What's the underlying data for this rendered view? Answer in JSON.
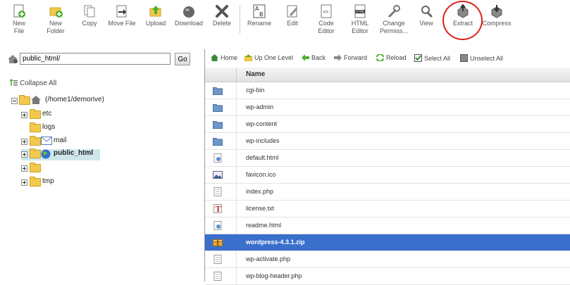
{
  "toolbar": {
    "buttons": [
      {
        "label": "New File",
        "icon": "new-file-icon"
      },
      {
        "label": "New\nFolder",
        "icon": "new-folder-icon"
      },
      {
        "label": "Copy",
        "icon": "copy-icon"
      },
      {
        "label": "Move File",
        "icon": "move-file-icon"
      },
      {
        "label": "Upload",
        "icon": "upload-icon"
      },
      {
        "label": "Download",
        "icon": "download-icon"
      },
      {
        "label": "Delete",
        "icon": "delete-icon"
      },
      {
        "label": "Rename",
        "icon": "rename-icon"
      },
      {
        "label": "Edit",
        "icon": "edit-icon"
      },
      {
        "label": "Code\nEditor",
        "icon": "code-editor-icon"
      },
      {
        "label": "HTML\nEditor",
        "icon": "html-editor-icon"
      },
      {
        "label": "Change\nPermiss...",
        "icon": "change-permissions-icon"
      },
      {
        "label": "View",
        "icon": "view-icon"
      },
      {
        "label": "Extract",
        "icon": "extract-icon"
      },
      {
        "label": "Compress",
        "icon": "compress-icon"
      }
    ],
    "highlight_color": "#d9231f"
  },
  "pathbar": {
    "value": "public_html/",
    "go_label": "Go"
  },
  "tree": {
    "collapse_label": "Collapse All",
    "root_label": "(/home1/demorive)",
    "items": [
      {
        "label": "etc"
      },
      {
        "label": "logs"
      },
      {
        "label": "mail"
      },
      {
        "label": "public_html"
      },
      {
        "label": ""
      },
      {
        "label": "tmp"
      }
    ]
  },
  "nav": {
    "home": "Home",
    "up": "Up One Level",
    "back": "Back",
    "forward": "Forward",
    "reload": "Reload",
    "select_all": "Select All",
    "unselect_all": "Unselect All"
  },
  "files": {
    "header": "Name",
    "rows": [
      {
        "name": "cgi-bin",
        "type": "folder"
      },
      {
        "name": "wp-admin",
        "type": "folder"
      },
      {
        "name": "wp-content",
        "type": "folder"
      },
      {
        "name": "wp-includes",
        "type": "folder"
      },
      {
        "name": "default.html",
        "type": "html"
      },
      {
        "name": "favicon.ico",
        "type": "image"
      },
      {
        "name": "index.php",
        "type": "text"
      },
      {
        "name": "license.txt",
        "type": "txt"
      },
      {
        "name": "readme.html",
        "type": "html"
      },
      {
        "name": "wordpress-4.3.1.zip",
        "type": "zip",
        "selected": true
      },
      {
        "name": "wp-activate.php",
        "type": "text"
      },
      {
        "name": "wp-blog-header.php",
        "type": "text"
      }
    ],
    "selected_color": "#3a6fcc"
  }
}
